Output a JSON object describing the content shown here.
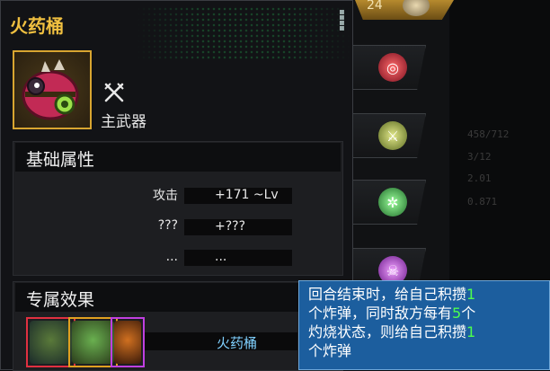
{
  "item": {
    "name": "火药桶",
    "weapon_type": "主武器"
  },
  "top_right": {
    "level": "24"
  },
  "sections": {
    "basic": "基础属性",
    "exclusive": "专属效果"
  },
  "stats": [
    {
      "label": "攻击",
      "value": "+171 ~Lv"
    },
    {
      "label": "???",
      "value": "+???"
    },
    {
      "label": "...",
      "value": "..."
    }
  ],
  "effect": {
    "name": "火药桶"
  },
  "tooltip": {
    "line1_a": "回合结束时，给自己积攒",
    "line1_num": "1",
    "line2_a": "个炸弹，同时敌方每有",
    "line2_num": "5",
    "line2_b": "个",
    "line3_a": "灼烧状态，则给自己积攒",
    "line3_num": "1",
    "line4": "个炸弹"
  },
  "ghost_stats": [
    "458/712",
    "3/12",
    "2.01",
    "0.871"
  ],
  "colors": {
    "title": "#f0c040",
    "portrait_border": "#d8a530",
    "card_borders": [
      "#e03040",
      "#e0a020",
      "#c040e0"
    ],
    "tooltip_bg": "#1c5e9e",
    "highlight": "#4dff4d"
  },
  "icons": [
    "crossed-swords-icon",
    "target-skill-icon",
    "blade-skill-icon",
    "tree-skill-icon",
    "skull-skill-icon"
  ]
}
